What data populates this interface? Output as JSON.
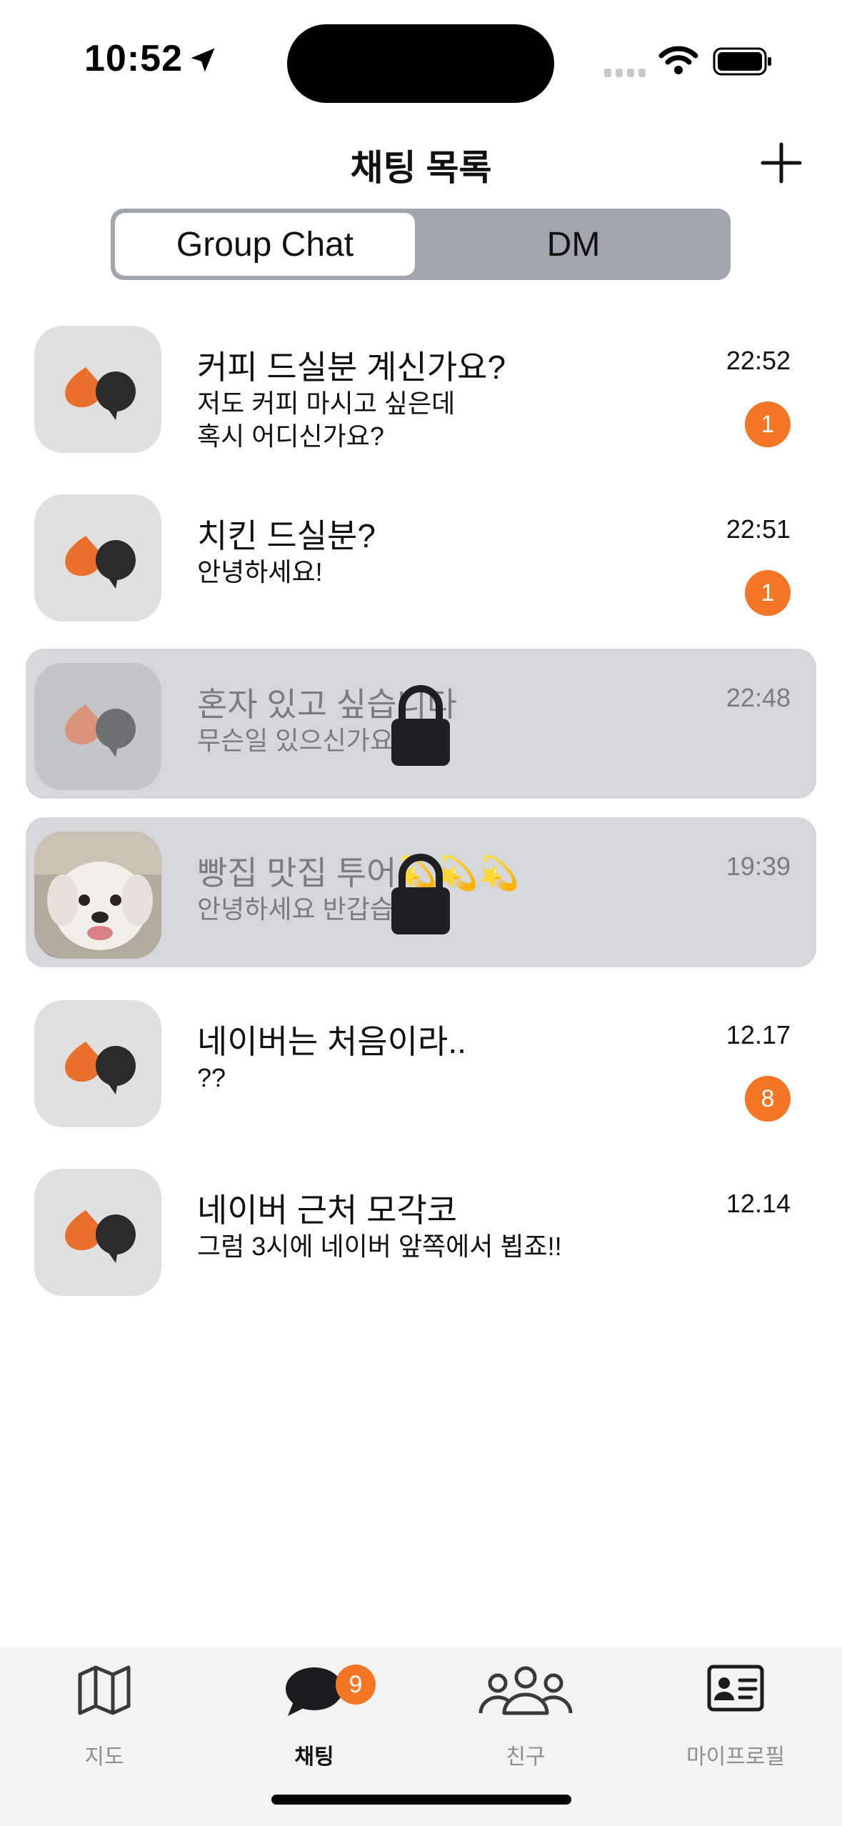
{
  "status_bar": {
    "time": "10:52"
  },
  "header": {
    "title": "채팅 목록",
    "add_icon": "plus-icon"
  },
  "segments": {
    "selected": "Group Chat",
    "other": "DM"
  },
  "chats": [
    {
      "title": "커피 드실분 계신가요?",
      "preview": "저도 커피 마시고 싶은데\n혹시 어디신가요?",
      "time": "22:52",
      "unread": "1",
      "locked": false
    },
    {
      "title": "치킨 드실분?",
      "preview": "안녕하세요!",
      "time": "22:51",
      "unread": "1",
      "locked": false
    },
    {
      "title": "혼자 있고 싶습니다",
      "preview": "무슨일 있으신가요",
      "time": "22:48",
      "locked": true
    },
    {
      "title": "빵집 맛집 투어💫💫💫",
      "preview": "안녕하세요 반갑습니다",
      "time": "19:39",
      "locked": true,
      "avatar": "dog-photo"
    },
    {
      "title": "네이버는 처음이라..",
      "preview": "??",
      "time": "12.17",
      "unread": "8",
      "locked": false
    },
    {
      "title": "네이버 근처 모각코",
      "preview": "그럼 3시에 네이버 앞쪽에서 뵙죠!!",
      "time": "12.14",
      "locked": false
    }
  ],
  "tabbar": {
    "tabs": [
      {
        "label": "지도",
        "icon": "map-icon"
      },
      {
        "label": "채팅",
        "icon": "chat-bubble-icon",
        "badge": "9",
        "active": true
      },
      {
        "label": "친구",
        "icon": "people-icon"
      },
      {
        "label": "마이프로필",
        "icon": "id-card-icon"
      }
    ]
  },
  "colors": {
    "accent": "#f47524",
    "locked_row": "#d6d7db",
    "segment_bg": "#a1a6ad"
  }
}
